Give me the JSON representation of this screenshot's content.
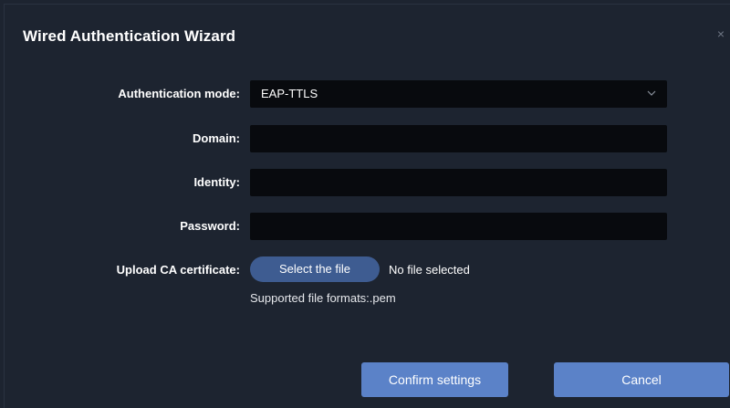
{
  "dialog": {
    "title": "Wired Authentication Wizard",
    "close_glyph": "×"
  },
  "form": {
    "auth_mode": {
      "label": "Authentication mode:",
      "value": "EAP-TTLS"
    },
    "domain": {
      "label": "Domain:",
      "value": ""
    },
    "identity": {
      "label": "Identity:",
      "value": ""
    },
    "password": {
      "label": "Password:",
      "value": ""
    },
    "upload_ca": {
      "label": "Upload CA certificate:",
      "button_label": "Select the file",
      "status": "No file selected",
      "hint": "Supported file formats:.pem"
    }
  },
  "actions": {
    "confirm_label": "Confirm settings",
    "cancel_label": "Cancel"
  },
  "colors": {
    "background": "#1d2430",
    "field_bg": "#080a0e",
    "primary_button": "#5b82c8",
    "file_button": "#3e5c91"
  },
  "icons": {
    "close": "close-icon",
    "dropdown": "chevron-down-icon"
  }
}
